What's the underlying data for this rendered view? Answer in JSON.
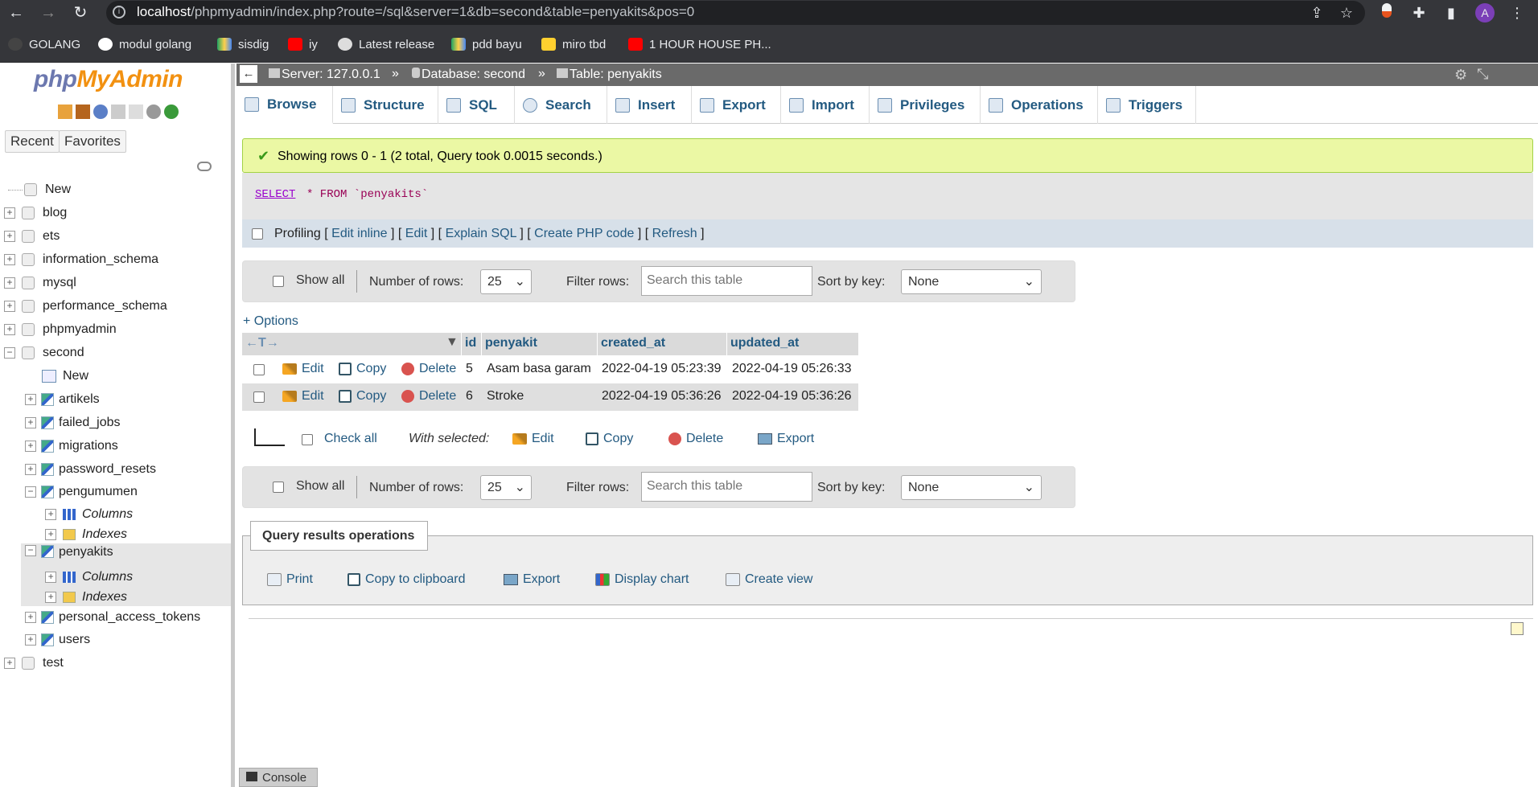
{
  "browser": {
    "url_host": "localhost",
    "url_path": "/phpmyadmin/index.php?route=/sql&server=1&db=second&table=penyakits&pos=0",
    "avatar": "A",
    "bookmarks": [
      "GOLANG",
      "modul golang",
      "sisdig",
      "iy",
      "Latest release",
      "pdd bayu",
      "miro tbd",
      "1 HOUR HOUSE PH..."
    ]
  },
  "sidebar": {
    "logo_php": "php",
    "logo_myadmin": "MyAdmin",
    "recent": "Recent",
    "favorites": "Favorites",
    "tree": [
      {
        "label": "New"
      },
      {
        "label": "blog"
      },
      {
        "label": "ets"
      },
      {
        "label": "information_schema"
      },
      {
        "label": "mysql"
      },
      {
        "label": "performance_schema"
      },
      {
        "label": "phpmyadmin"
      },
      {
        "label": "second"
      },
      {
        "label": "New"
      },
      {
        "label": "artikels"
      },
      {
        "label": "failed_jobs"
      },
      {
        "label": "migrations"
      },
      {
        "label": "password_resets"
      },
      {
        "label": "pengumumen"
      },
      {
        "label": "Columns"
      },
      {
        "label": "Indexes"
      },
      {
        "label": "penyakits"
      },
      {
        "label": "Columns"
      },
      {
        "label": "Indexes"
      },
      {
        "label": "personal_access_tokens"
      },
      {
        "label": "users"
      },
      {
        "label": "test"
      }
    ]
  },
  "breadcrumb": {
    "server": "Server: 127.0.0.1",
    "database": "Database: second",
    "table": "Table: penyakits",
    "sep": "»"
  },
  "tabs": [
    "Browse",
    "Structure",
    "SQL",
    "Search",
    "Insert",
    "Export",
    "Import",
    "Privileges",
    "Operations",
    "Triggers"
  ],
  "message": "Showing rows 0 - 1 (2 total, Query took 0.0015 seconds.)",
  "sql": {
    "select": "SELECT",
    "rest": "* FROM `penyakits`"
  },
  "profiling": {
    "label": "Profiling",
    "links": [
      "Edit inline",
      "Edit",
      "Explain SQL",
      "Create PHP code",
      "Refresh"
    ]
  },
  "nav": {
    "show_all": "Show all",
    "num_rows_label": "Number of rows:",
    "num_rows": "25",
    "filter_label": "Filter rows:",
    "filter_placeholder": "Search this table",
    "sort_label": "Sort by key:",
    "sort_value": "None"
  },
  "options": "+ Options",
  "table": {
    "arrows": "←T→",
    "headers": [
      "id",
      "penyakit",
      "created_at",
      "updated_at"
    ],
    "actions": {
      "edit": "Edit",
      "copy": "Copy",
      "delete": "Delete"
    },
    "rows": [
      [
        "5",
        "Asam basa garam",
        "2022-04-19 05:23:39",
        "2022-04-19 05:26:33"
      ],
      [
        "6",
        "Stroke",
        "2022-04-19 05:36:26",
        "2022-04-19 05:36:26"
      ]
    ]
  },
  "bulk": {
    "check_all": "Check all",
    "with_selected": "With selected:",
    "edit": "Edit",
    "copy": "Copy",
    "delete": "Delete",
    "export": "Export"
  },
  "qro": {
    "title": "Query results operations",
    "items": [
      "Print",
      "Copy to clipboard",
      "Export",
      "Display chart",
      "Create view"
    ]
  },
  "console": "Console"
}
